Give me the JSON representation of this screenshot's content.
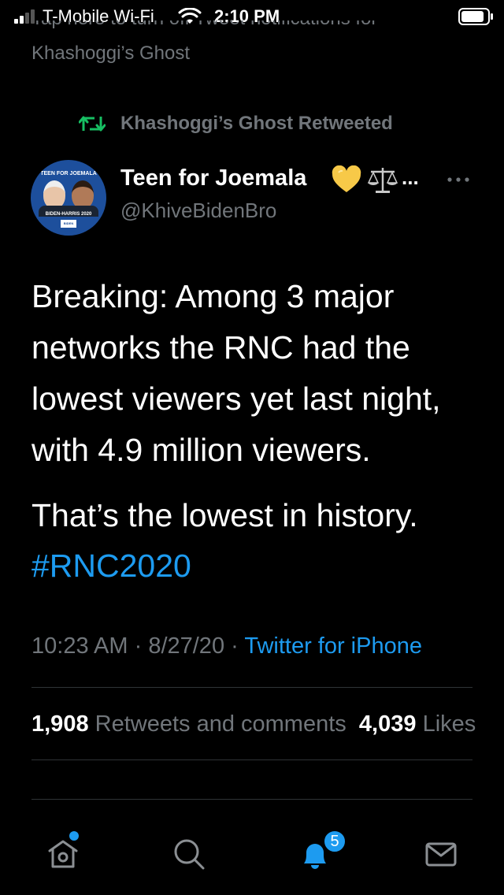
{
  "status_bar": {
    "carrier": "T-Mobile Wi-Fi",
    "time": "2:10 PM",
    "signal_bars_active": 2,
    "signal_bars_total": 4
  },
  "notification_banner": {
    "text": "Tap here to turn off Tweet notifications for",
    "name": "Khashoggi’s Ghost"
  },
  "retweet_context": {
    "label": "Khashoggi’s Ghost Retweeted",
    "icon": "retweet-icon",
    "color": "#17bf63"
  },
  "author": {
    "display_name": "Teen for Joemala",
    "name_emoji": [
      "yellow-heart-icon",
      "scales-icon"
    ],
    "truncation": "...",
    "handle": "@KhiveBidenBro",
    "avatar": {
      "top_text": "TEEN FOR JOEMALA",
      "bottom_text": "BIDEN-HARRIS 2020",
      "badge_text": "BIDEN HARRIS"
    }
  },
  "tweet": {
    "text": "Breaking: Among 3 major networks the RNC had the lowest viewers yet last night, with 4.9 million viewers.",
    "text2": "That’s the lowest in history.",
    "hashtag": "#RNC2020",
    "time": "10:23 AM",
    "separator": " · ",
    "date": "8/27/20",
    "source": "Twitter for iPhone"
  },
  "stats": {
    "retweets_count": "1,908",
    "retweets_label": "Retweets and comments",
    "likes_count": "4,039",
    "likes_label": "Likes"
  },
  "tab_bar": {
    "tabs": [
      "home",
      "search",
      "notifications",
      "messages"
    ],
    "notifications_badge": "5"
  },
  "colors": {
    "background": "#000000",
    "text_primary": "#ffffff",
    "text_secondary": "#71767b",
    "accent": "#1d9bf0",
    "retweet_green": "#17bf63",
    "divider": "#2f3336"
  }
}
